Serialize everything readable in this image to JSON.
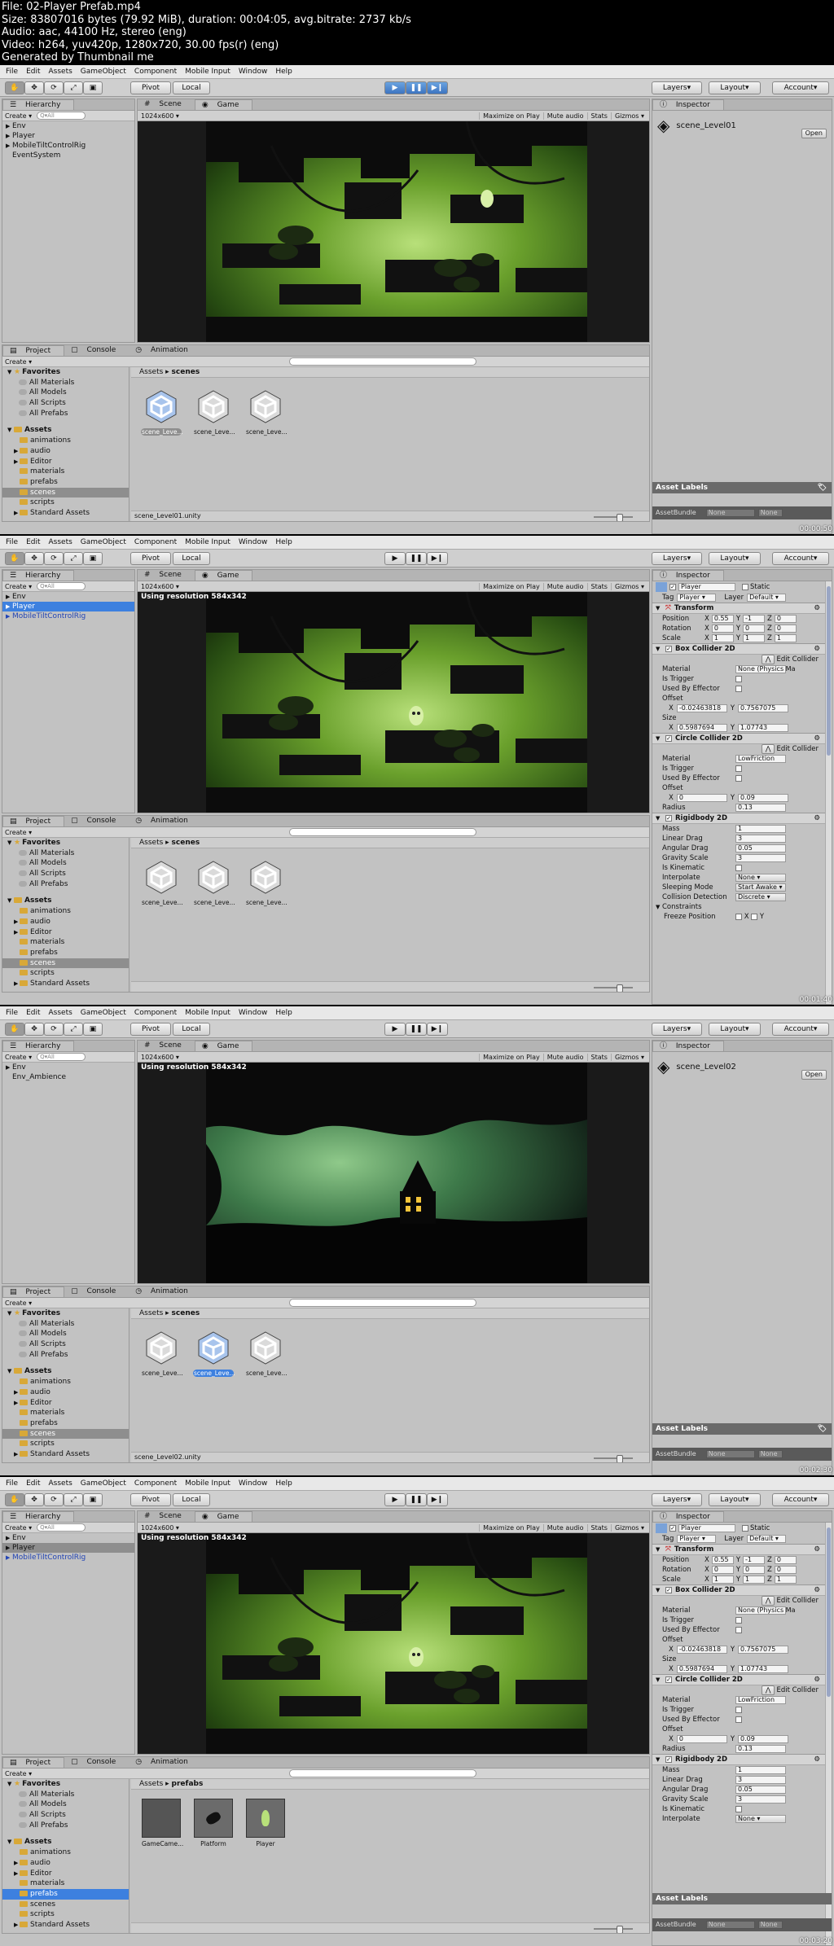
{
  "header": {
    "lines": [
      "File: 02-Player Prefab.mp4",
      "Size: 83807016 bytes (79.92 MiB), duration: 00:04:05, avg.bitrate: 2737 kb/s",
      "Audio: aac, 44100 Hz, stereo (eng)",
      "Video: h264, yuv420p, 1280x720, 30.00 fps(r) (eng)",
      "Generated by Thumbnail me"
    ]
  },
  "menu": [
    "File",
    "Edit",
    "Assets",
    "GameObject",
    "Component",
    "Mobile Input",
    "Window",
    "Help"
  ],
  "toolbar": {
    "pivot": "Pivot",
    "local": "Local",
    "layers": "Layers",
    "layout": "Layout",
    "account": "Account"
  },
  "tabs": {
    "hierarchy": "Hierarchy",
    "scene": "Scene",
    "game": "Game",
    "inspector": "Inspector",
    "project": "Project",
    "console": "Console",
    "animation": "Animation"
  },
  "create": "Create",
  "search_all": "Q▾All",
  "game_bar": {
    "res": "1024x600",
    "maximize": "Maximize on Play",
    "mute": "Mute audio",
    "stats": "Stats",
    "gizmos": "Gizmos"
  },
  "using_res": "Using resolution 584x342",
  "project": {
    "favorites": "Favorites",
    "fav_items": [
      "All Materials",
      "All Models",
      "All Scripts",
      "All Prefabs"
    ],
    "assets": "Assets",
    "folders": [
      "animations",
      "audio",
      "Editor",
      "materials",
      "prefabs",
      "scenes",
      "scripts",
      "Standard Assets"
    ]
  },
  "asset_labels": "Asset Labels",
  "asset_bundle": "AssetBundle",
  "none": "None",
  "open": "Open",
  "frames": [
    {
      "timestamp": "00:00:50",
      "hierarchy": [
        "Env",
        "Player",
        "MobileTiltControlRig",
        "EventSystem"
      ],
      "crumb_root": "Assets",
      "crumb_leaf": "scenes",
      "tiles": [
        "scene_Leve...",
        "scene_Leve...",
        "scene_Leve..."
      ],
      "footer": "scene_Level01.unity",
      "inspector_title": "scene_Level01"
    },
    {
      "timestamp": "00:01:40",
      "hierarchy": [
        "Env",
        "Player",
        "MobileTiltControlRig"
      ],
      "crumb_root": "Assets",
      "crumb_leaf": "scenes",
      "tiles": [
        "scene_Leve...",
        "scene_Leve...",
        "scene_Leve..."
      ],
      "footer": ""
    },
    {
      "timestamp": "00:02:30",
      "hierarchy": [
        "Env",
        "Env_Ambience"
      ],
      "crumb_root": "Assets",
      "crumb_leaf": "scenes",
      "tiles": [
        "scene_Leve...",
        "scene_Leve...",
        "scene_Leve..."
      ],
      "footer": "scene_Level02.unity",
      "inspector_title": "scene_Level02"
    },
    {
      "timestamp": "00:03:20",
      "hierarchy": [
        "Env",
        "Player",
        "MobileTiltControlRig"
      ],
      "crumb_root": "Assets",
      "crumb_leaf": "prefabs",
      "tiles": [
        "GameCame...",
        "Platform",
        "Player"
      ],
      "footer": ""
    }
  ],
  "player_inspector": {
    "name": "Player",
    "static": "Static",
    "tag_label": "Tag",
    "tag": "Player",
    "layer_label": "Layer",
    "layer": "Default",
    "transform": "Transform",
    "position": {
      "label": "Position",
      "x": "0.55",
      "y": "-1",
      "z": "0"
    },
    "rotation": {
      "label": "Rotation",
      "x": "0",
      "y": "0",
      "z": "0"
    },
    "scale": {
      "label": "Scale",
      "x": "1",
      "y": "1",
      "z": "1"
    },
    "box": "Box Collider 2D",
    "edit_collider": "Edit Collider",
    "material": "Material",
    "box_material": "None (Physics Ma",
    "is_trigger": "Is Trigger",
    "used_by_effector": "Used By Effector",
    "offset": "Offset",
    "box_offset": {
      "x": "-0.02463818",
      "y": "0.7567075"
    },
    "size": "Size",
    "box_size": {
      "x": "0.5987694",
      "y": "1.07743"
    },
    "circle": "Circle Collider 2D",
    "circle_material": "LowFriction",
    "circle_offset": {
      "x": "0",
      "y": "0.09"
    },
    "radius": "Radius",
    "radius_val": "0.13",
    "rigidbody": "Rigidbody 2D",
    "mass": "Mass",
    "mass_val": "1",
    "linear_drag": "Linear Drag",
    "linear_drag_val": "3",
    "angular_drag": "Angular Drag",
    "angular_drag_val": "0.05",
    "gravity": "Gravity Scale",
    "gravity_val": "3",
    "kinematic": "Is Kinematic",
    "interpolate": "Interpolate",
    "interpolate_val": "None",
    "sleeping": "Sleeping Mode",
    "sleeping_val": "Start Awake",
    "collision": "Collision Detection",
    "collision_val": "Discrete",
    "constraints": "Constraints",
    "freeze": "Freeze Position"
  },
  "colors": {
    "selection": "#3d80df",
    "panel": "#c2c2c2",
    "play_active": "#3d74c0"
  }
}
